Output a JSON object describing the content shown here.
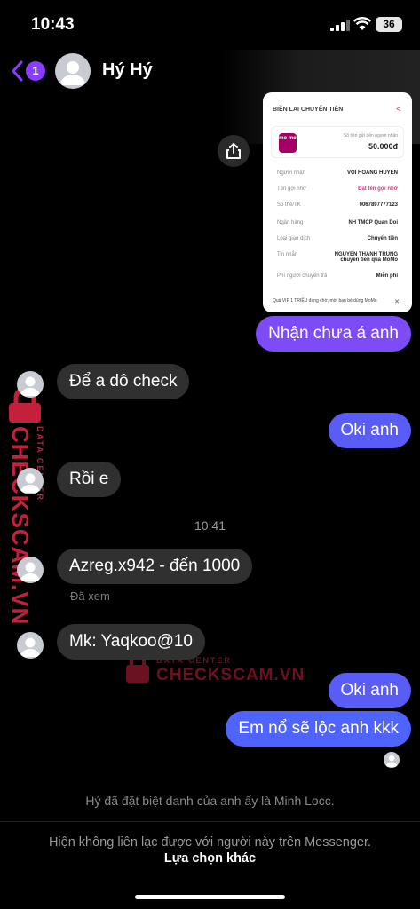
{
  "status_bar": {
    "time": "10:43",
    "battery": "36"
  },
  "header": {
    "unread_count": "1",
    "contact_name": "Hý Hý"
  },
  "receipt": {
    "title": "BIÊN LAI CHUYỂN TIỀN",
    "logo": "mo mo",
    "amount_label": "Số tiền gửi đến người nhận",
    "amount": "50.000đ",
    "rows": [
      {
        "key": "Người nhận",
        "value": "VOI HOANG HUYEN"
      },
      {
        "key": "Tên gợi nhớ",
        "value": "Đặt tên gợi nhớ"
      },
      {
        "key": "Số thẻ/TK",
        "value": "0067897777123"
      },
      {
        "key": "Ngân hàng",
        "value": "NH TMCP Quan Doi"
      },
      {
        "key": "Loại giao dịch",
        "value": "Chuyển tiền"
      },
      {
        "key": "Tin nhắn",
        "value": "NGUYEN THANH TRUNG chuyen tien qua MoMo"
      },
      {
        "key": "Phí người chuyển trả",
        "value": "Miễn phí"
      }
    ],
    "footer": "Quà VIP 1 TRIỆU đang chờ, mời bạn bè dùng MoMo"
  },
  "messages": [
    {
      "text": "Nhận chưa á anh"
    },
    {
      "text": "Để a dô check"
    },
    {
      "text": "Oki anh"
    },
    {
      "text": "Rồi e"
    },
    {
      "text": "Azreg.x942 - đến 1000"
    },
    {
      "text": "Mk: Yaqkoo@10"
    },
    {
      "text": "Oki anh"
    },
    {
      "text": "Em nổ sẽ lộc anh kkk"
    }
  ],
  "timestamp": "10:41",
  "seen_label": "Đã xem",
  "nickname_notice": "Hý đã đặt biệt danh của anh ấy là Minh Locc.",
  "unavailable_notice": "Hiện không liên lạc được với người này trên Messenger.",
  "other_options": "Lựa chọn khác",
  "watermark": {
    "brand": "CHECKSCAM.VN",
    "sub": "DATA CENTER"
  },
  "colors": {
    "accent": "#8b3dff",
    "outgoing": "#5a5cf6",
    "incoming": "#303030",
    "watermark": "#c41f3b"
  }
}
